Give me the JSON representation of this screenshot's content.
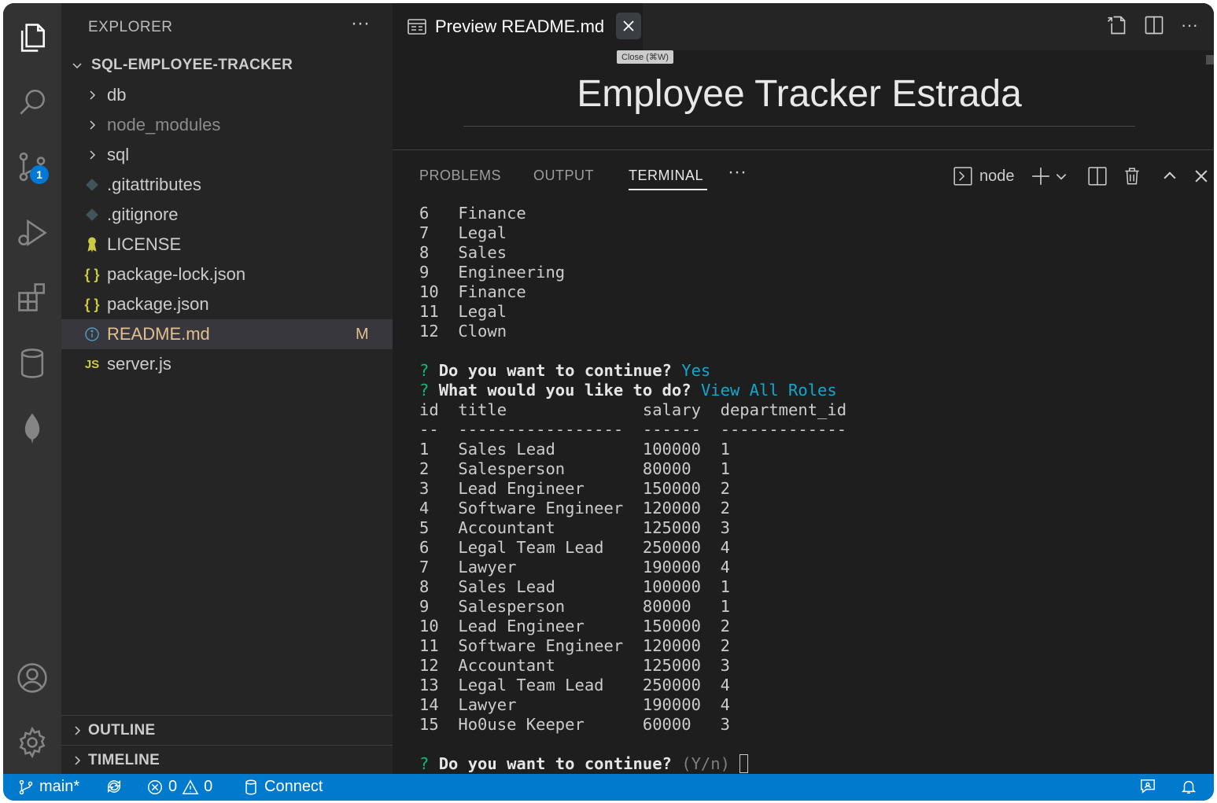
{
  "activity_bar": {
    "icons": [
      "files-icon",
      "search-icon",
      "source-control-icon",
      "run-debug-icon",
      "extensions-icon",
      "database-icon",
      "mongodb-leaf-icon",
      "account-icon",
      "settings-gear-icon"
    ],
    "scm_badge": "1"
  },
  "sidebar": {
    "title": "EXPLORER",
    "more": "···",
    "project": "SQL-EMPLOYEE-TRACKER",
    "items": [
      {
        "label": "db",
        "type": "folder"
      },
      {
        "label": "node_modules",
        "type": "folder"
      },
      {
        "label": "sql",
        "type": "folder"
      },
      {
        "label": ".gitattributes",
        "type": "git"
      },
      {
        "label": ".gitignore",
        "type": "git"
      },
      {
        "label": "LICENSE",
        "type": "license"
      },
      {
        "label": "package-lock.json",
        "type": "json",
        "icon": "{ }"
      },
      {
        "label": "package.json",
        "type": "json",
        "icon": "{ }"
      },
      {
        "label": "README.md",
        "type": "info",
        "status": "M"
      },
      {
        "label": "server.js",
        "type": "js",
        "icon": "JS"
      }
    ],
    "outline": "OUTLINE",
    "timeline": "TIMELINE"
  },
  "editor": {
    "tab_label": "Preview README.md",
    "tooltip": "Close (⌘W)",
    "preview_heading": "Employee Tracker Estrada"
  },
  "panel": {
    "tabs": [
      "PROBLEMS",
      "OUTPUT",
      "TERMINAL"
    ],
    "more": "···",
    "terminal_name": "node",
    "dept_rows": [
      [
        "6",
        "Finance"
      ],
      [
        "7",
        "Legal"
      ],
      [
        "8",
        "Sales"
      ],
      [
        "9",
        "Engineering"
      ],
      [
        "10",
        "Finance"
      ],
      [
        "11",
        "Legal"
      ],
      [
        "12",
        "Clown"
      ]
    ],
    "prompt1": {
      "mark": "?",
      "question": "Do you want to continue?",
      "answer": "Yes"
    },
    "prompt2": {
      "mark": "?",
      "question": "What would you like to do?",
      "answer": "View All Roles"
    },
    "role_header": [
      "id",
      "title",
      "salary",
      "department_id"
    ],
    "role_separator": [
      "--",
      "-----------------",
      "------",
      "-------------"
    ],
    "roles": [
      [
        "1",
        "Sales Lead",
        "100000",
        "1"
      ],
      [
        "2",
        "Salesperson",
        "80000",
        "1"
      ],
      [
        "3",
        "Lead Engineer",
        "150000",
        "2"
      ],
      [
        "4",
        "Software Engineer",
        "120000",
        "2"
      ],
      [
        "5",
        "Accountant",
        "125000",
        "3"
      ],
      [
        "6",
        "Legal Team Lead",
        "250000",
        "4"
      ],
      [
        "7",
        "Lawyer",
        "190000",
        "4"
      ],
      [
        "8",
        "Sales Lead",
        "100000",
        "1"
      ],
      [
        "9",
        "Salesperson",
        "80000",
        "1"
      ],
      [
        "10",
        "Lead Engineer",
        "150000",
        "2"
      ],
      [
        "11",
        "Software Engineer",
        "120000",
        "2"
      ],
      [
        "12",
        "Accountant",
        "125000",
        "3"
      ],
      [
        "13",
        "Legal Team Lead",
        "250000",
        "4"
      ],
      [
        "14",
        "Lawyer",
        "190000",
        "4"
      ],
      [
        "15",
        "Ho0use Keeper",
        "60000",
        "3"
      ]
    ],
    "prompt3": {
      "mark": "?",
      "question": "Do you want to continue?",
      "hint": "(Y/n)"
    }
  },
  "statusbar": {
    "branch": "main*",
    "errors": "0",
    "warnings": "0",
    "connect": "Connect"
  },
  "colors": {
    "accent": "#007acc",
    "modified": "#e2c08d",
    "prompt_green": "#0dbc79",
    "answer_cyan": "#11a8cd"
  }
}
